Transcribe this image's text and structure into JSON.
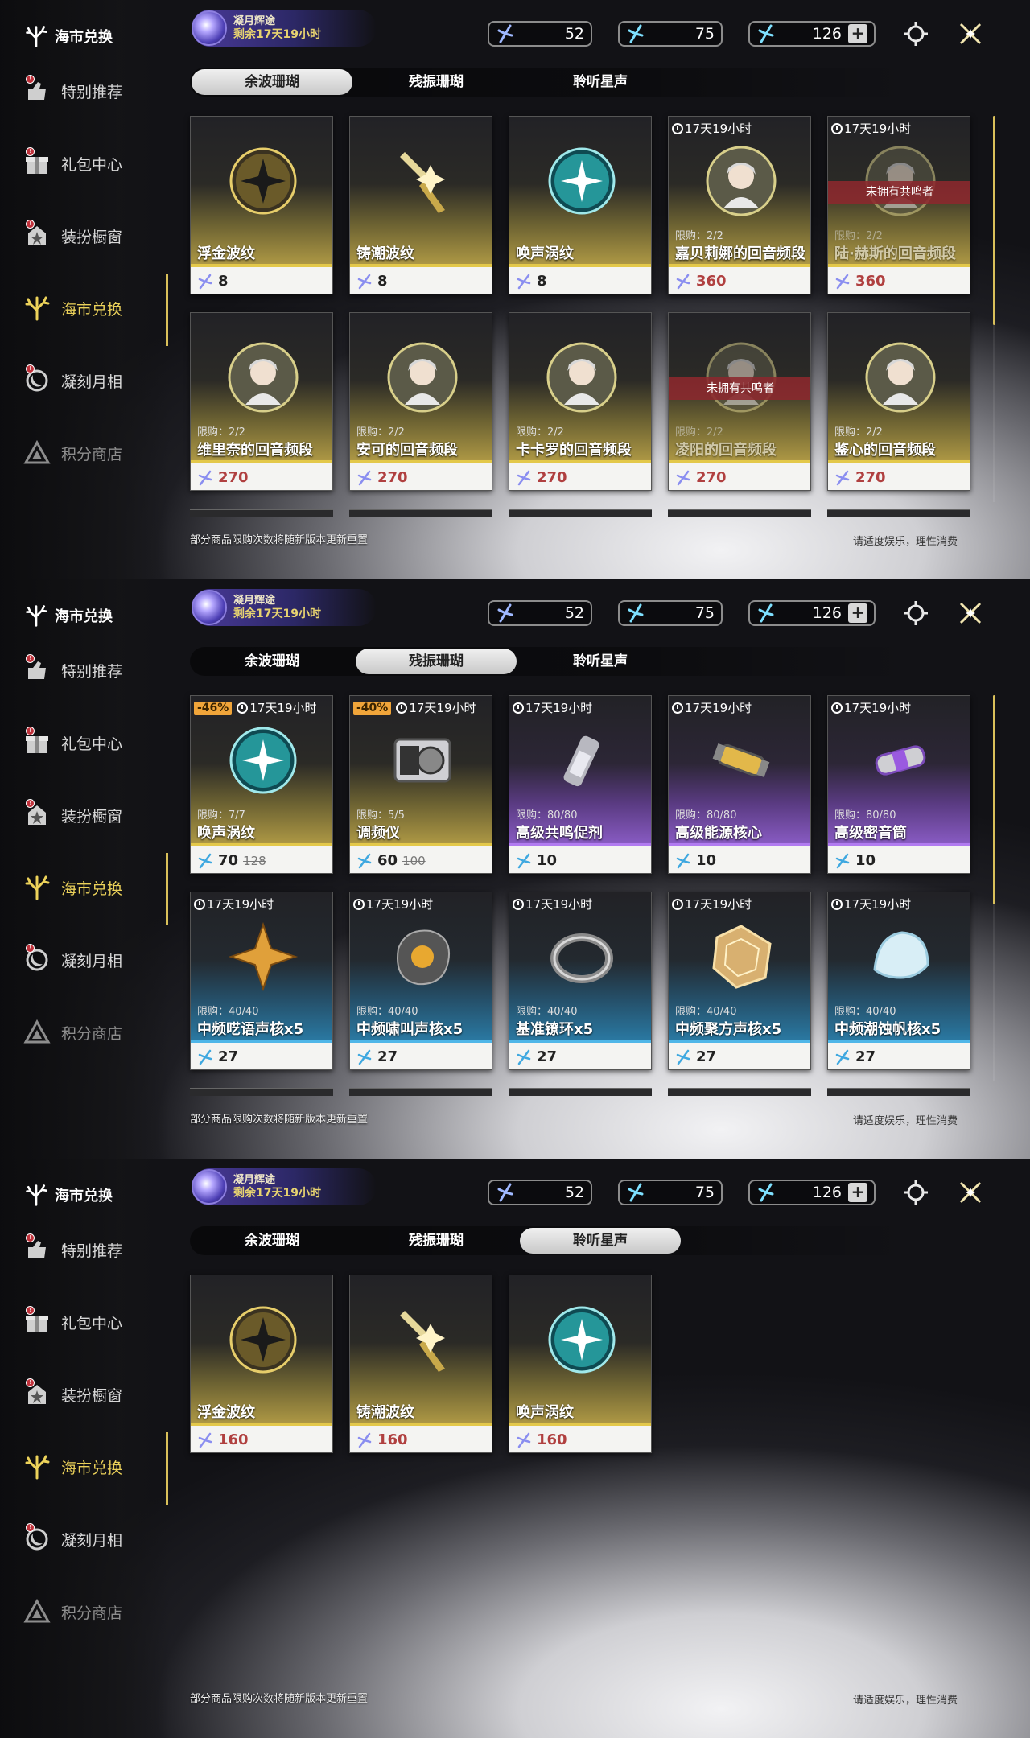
{
  "panels": [
    {
      "sidebar": {
        "title": "海市兑换",
        "items": [
          {
            "label": "特别推荐",
            "icon": "recommend-icon",
            "badge": "!"
          },
          {
            "label": "礼包中心",
            "icon": "gift-icon",
            "badge": "!"
          },
          {
            "label": "装扮橱窗",
            "icon": "wardrobe-icon",
            "badge": "!"
          },
          {
            "label": "海市兑换",
            "icon": "coral-icon",
            "badge": ""
          },
          {
            "label": "凝刻月相",
            "icon": "moon-icon",
            "badge": "!"
          },
          {
            "label": "积分商店",
            "icon": "points-icon",
            "badge": ""
          }
        ]
      },
      "event": {
        "name": "凝月辉途",
        "remain": "剩余17天19小时"
      },
      "currencies": [
        {
          "value": "52"
        },
        {
          "value": "75"
        },
        {
          "value": "126"
        }
      ],
      "plus": "+",
      "tabs": [
        "余波珊瑚",
        "残振珊瑚",
        "聆听星声"
      ],
      "selected_tab": 0,
      "cards": [
        {
          "name": "浮金波纹",
          "price": "8",
          "color": "gold",
          "timer": "",
          "limit": "",
          "icon": "gold-orb-icon"
        },
        {
          "name": "铸潮波纹",
          "price": "8",
          "color": "gold",
          "timer": "",
          "limit": "",
          "icon": "gold-blade-icon"
        },
        {
          "name": "唤声涡纹",
          "price": "8",
          "color": "gold",
          "timer": "",
          "limit": "",
          "icon": "teal-orb-icon"
        },
        {
          "name": "嘉贝莉娜的回音频段",
          "price": "360",
          "color": "gold",
          "timer": "17天19小时",
          "limit": "限购：2/2",
          "icon": "character-portrait-icon"
        },
        {
          "name": "陆·赫斯的回音频段",
          "price": "360",
          "color": "gold",
          "timer": "17天19小时",
          "limit": "限购：2/2",
          "icon": "character-portrait-icon",
          "notown": "未拥有共鸣者"
        },
        {
          "name": "维里奈的回音频段",
          "price": "270",
          "color": "gold",
          "timer": "",
          "limit": "限购：2/2",
          "icon": "character-portrait-icon"
        },
        {
          "name": "安可的回音频段",
          "price": "270",
          "color": "gold",
          "timer": "",
          "limit": "限购：2/2",
          "icon": "character-portrait-icon"
        },
        {
          "name": "卡卡罗的回音频段",
          "price": "270",
          "color": "gold",
          "timer": "",
          "limit": "限购：2/2",
          "icon": "character-portrait-icon"
        },
        {
          "name": "凌阳的回音频段",
          "price": "270",
          "color": "gold",
          "timer": "",
          "limit": "限购：2/2",
          "icon": "character-portrait-icon",
          "notown": "未拥有共鸣者"
        },
        {
          "name": "鉴心的回音频段",
          "price": "270",
          "color": "gold",
          "timer": "",
          "limit": "限购：2/2",
          "icon": "character-portrait-icon"
        }
      ],
      "footer_left": "部分商品限购次数将随新版本更新重置",
      "footer_right": "请适度娱乐，理性消费"
    },
    {
      "sidebar": {
        "title": "海市兑换",
        "items": [
          {
            "label": "特别推荐",
            "icon": "recommend-icon",
            "badge": "!"
          },
          {
            "label": "礼包中心",
            "icon": "gift-icon",
            "badge": "!"
          },
          {
            "label": "装扮橱窗",
            "icon": "wardrobe-icon",
            "badge": "!"
          },
          {
            "label": "海市兑换",
            "icon": "coral-icon",
            "badge": ""
          },
          {
            "label": "凝刻月相",
            "icon": "moon-icon",
            "badge": "!"
          },
          {
            "label": "积分商店",
            "icon": "points-icon",
            "badge": ""
          }
        ]
      },
      "event": {
        "name": "凝月辉途",
        "remain": "剩余17天19小时"
      },
      "currencies": [
        {
          "value": "52"
        },
        {
          "value": "75"
        },
        {
          "value": "126"
        }
      ],
      "plus": "+",
      "tabs": [
        "余波珊瑚",
        "残振珊瑚",
        "聆听星声"
      ],
      "selected_tab": 1,
      "cards": [
        {
          "name": "唤声涡纹",
          "price": "70",
          "old": "128",
          "discount": "-46%",
          "color": "gold",
          "timer": "17天19小时",
          "limit": "限购：7/7",
          "icon": "teal-orb-icon"
        },
        {
          "name": "调频仪",
          "price": "60",
          "old": "100",
          "discount": "-40%",
          "color": "gold",
          "timer": "17天19小时",
          "limit": "限购：5/5",
          "icon": "tuner-device-icon"
        },
        {
          "name": "高级共鸣促剂",
          "price": "10",
          "color": "purple",
          "timer": "17天19小时",
          "limit": "限购：80/80",
          "icon": "vial-icon"
        },
        {
          "name": "高级能源核心",
          "price": "10",
          "color": "purple",
          "timer": "17天19小时",
          "limit": "限购：80/80",
          "icon": "energy-core-icon"
        },
        {
          "name": "高级密音筒",
          "price": "10",
          "color": "purple",
          "timer": "17天19小时",
          "limit": "限购：80/80",
          "icon": "sound-tube-icon"
        },
        {
          "name": "中频呓语声核x5",
          "price": "27",
          "color": "blue",
          "timer": "17天19小时",
          "limit": "限购：40/40",
          "icon": "star-core-icon"
        },
        {
          "name": "中频啸叫声核x5",
          "price": "27",
          "color": "blue",
          "timer": "17天19小时",
          "limit": "限购：40/40",
          "icon": "howl-core-icon"
        },
        {
          "name": "基准镣环x5",
          "price": "27",
          "color": "blue",
          "timer": "17天19小时",
          "limit": "限购：40/40",
          "icon": "ring-icon"
        },
        {
          "name": "中频聚方声核x5",
          "price": "27",
          "color": "blue",
          "timer": "17天19小时",
          "limit": "限购：40/40",
          "icon": "polygon-core-icon"
        },
        {
          "name": "中频潮蚀帆核x5",
          "price": "27",
          "color": "blue",
          "timer": "17天19小时",
          "limit": "限购：40/40",
          "icon": "shell-core-icon"
        }
      ],
      "footer_left": "部分商品限购次数将随新版本更新重置",
      "footer_right": "请适度娱乐，理性消费"
    },
    {
      "sidebar": {
        "title": "海市兑换",
        "items": [
          {
            "label": "特别推荐",
            "icon": "recommend-icon",
            "badge": "!"
          },
          {
            "label": "礼包中心",
            "icon": "gift-icon",
            "badge": "!"
          },
          {
            "label": "装扮橱窗",
            "icon": "wardrobe-icon",
            "badge": "!"
          },
          {
            "label": "海市兑换",
            "icon": "coral-icon",
            "badge": ""
          },
          {
            "label": "凝刻月相",
            "icon": "moon-icon",
            "badge": "!"
          },
          {
            "label": "积分商店",
            "icon": "points-icon",
            "badge": ""
          }
        ]
      },
      "event": {
        "name": "凝月辉途",
        "remain": "剩余17天19小时"
      },
      "currencies": [
        {
          "value": "52"
        },
        {
          "value": "75"
        },
        {
          "value": "126"
        }
      ],
      "plus": "+",
      "tabs": [
        "余波珊瑚",
        "残振珊瑚",
        "聆听星声"
      ],
      "selected_tab": 2,
      "cards": [
        {
          "name": "浮金波纹",
          "price": "160",
          "color": "gold",
          "timer": "",
          "limit": "",
          "icon": "gold-orb-icon"
        },
        {
          "name": "铸潮波纹",
          "price": "160",
          "color": "gold",
          "timer": "",
          "limit": "",
          "icon": "gold-blade-icon"
        },
        {
          "name": "唤声涡纹",
          "price": "160",
          "color": "gold",
          "timer": "",
          "limit": "",
          "icon": "teal-orb-icon"
        }
      ],
      "footer_left": "部分商品限购次数将随新版本更新重置",
      "footer_right": "请适度娱乐，理性消费"
    }
  ]
}
